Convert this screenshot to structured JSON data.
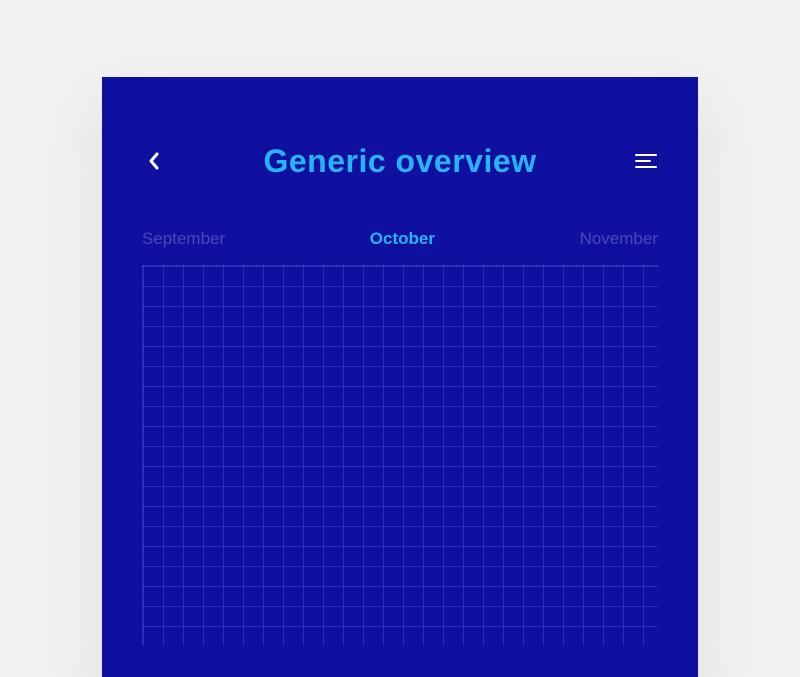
{
  "header": {
    "title": "Generic overview",
    "back_icon": "chevron-left",
    "menu_icon": "menu"
  },
  "month_nav": {
    "prev": "September",
    "current": "October",
    "next": "November"
  },
  "colors": {
    "primary_bg": "#0F0FA0",
    "accent": "#27B4F5",
    "grid_line": "rgba(100, 100, 220, 0.35)",
    "inactive_text": "rgba(120, 120, 210, 0.55)",
    "outer_bg": "#f1f1f2"
  },
  "chart_data": {
    "type": "line",
    "title": "Generic overview",
    "xlabel": "",
    "ylabel": "",
    "categories": [],
    "values": [],
    "grid": true,
    "notes": "Empty grid — no data series visible in the screenshot"
  }
}
